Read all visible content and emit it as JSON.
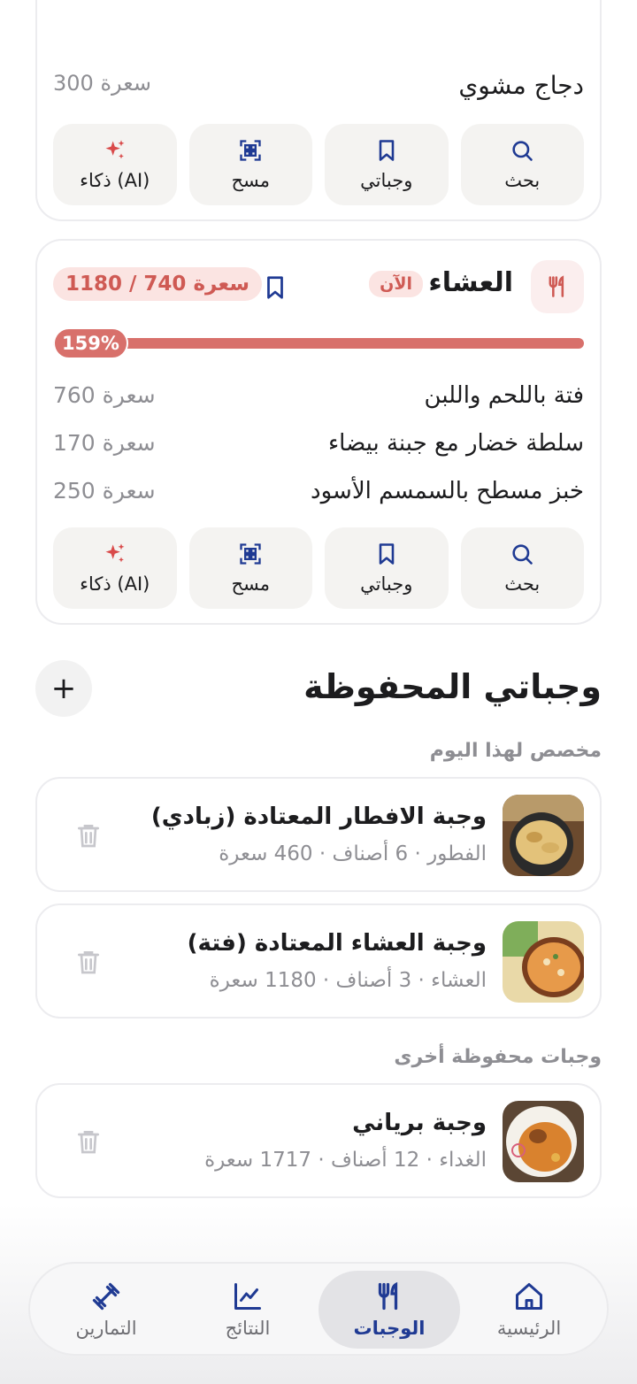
{
  "colors": {
    "accent": "#d8706b",
    "accent_bg": "#fbe4e2",
    "navy": "#1f3a93",
    "muted": "#8e8e93"
  },
  "prev_card": {
    "item_name": "دجاج مشوي",
    "item_kcal": "300 سعرة"
  },
  "actions": {
    "search": "بحث",
    "my_meals": "وجباتي",
    "scan": "مسح",
    "ai": "ذكاء (AI)"
  },
  "dinner": {
    "title": "العشاء",
    "now_badge": "الآن",
    "kcal_pill": "1180 / 740 سعرة",
    "progress_label": "159%",
    "progress_fraction": 1.59,
    "items": [
      {
        "name": "فتة باللحم واللبن",
        "kcal": "760 سعرة"
      },
      {
        "name": "سلطة خضار مع جبنة بيضاء",
        "kcal": "170 سعرة"
      },
      {
        "name": "خبز مسطح بالسمسم الأسود",
        "kcal": "250 سعرة"
      }
    ]
  },
  "saved": {
    "title": "وجباتي المحفوظة",
    "today_heading": "مخصص لهذا اليوم",
    "other_heading": "وجبات محفوظة أخرى",
    "meals": [
      {
        "name": "وجبة الافطار المعتادة (زبادي)",
        "meta": "الفطور · 6 أصناف · 460 سعرة"
      },
      {
        "name": "وجبة العشاء المعتادة (فتة)",
        "meta": "العشاء · 3 أصناف · 1180 سعرة"
      },
      {
        "name": "وجبة برياني",
        "meta": "الغداء · 12 أصناف · 1717 سعرة"
      }
    ]
  },
  "nav": {
    "home": "الرئيسية",
    "meals": "الوجبات",
    "results": "النتائج",
    "workouts": "التمارين"
  }
}
